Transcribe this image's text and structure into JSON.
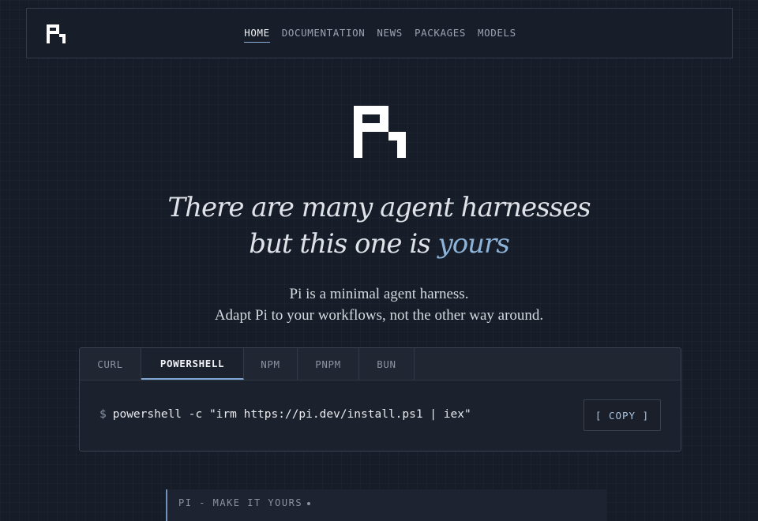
{
  "nav": {
    "logo": "pi-logo",
    "links": [
      {
        "label": "HOME",
        "active": true
      },
      {
        "label": "DOCUMENTATION",
        "active": false
      },
      {
        "label": "NEWS",
        "active": false
      },
      {
        "label": "PACKAGES",
        "active": false
      },
      {
        "label": "MODELS",
        "active": false
      }
    ]
  },
  "hero": {
    "logo": "pi-logo",
    "headline_line1": "There are many agent harnesses",
    "headline_line2_prefix": "but this one is ",
    "headline_line2_accent": "yours",
    "tagline_line1": "Pi is a minimal agent harness.",
    "tagline_line2": "Adapt Pi to your workflows, not the other way around."
  },
  "install": {
    "tabs": [
      {
        "label": "CURL",
        "active": false
      },
      {
        "label": "POWERSHELL",
        "active": true
      },
      {
        "label": "NPM",
        "active": false
      },
      {
        "label": "PNPM",
        "active": false
      },
      {
        "label": "BUN",
        "active": false
      }
    ],
    "prompt": "$",
    "command": "powershell -c \"irm https://pi.dev/install.ps1 | iex\"",
    "copy_label": "[ COPY ]"
  },
  "section": {
    "label": "PI - MAKE IT YOURS"
  },
  "colors": {
    "background": "#171d28",
    "accent": "#8db3d9",
    "text": "#e6e8ec",
    "muted": "#8a93a3"
  }
}
